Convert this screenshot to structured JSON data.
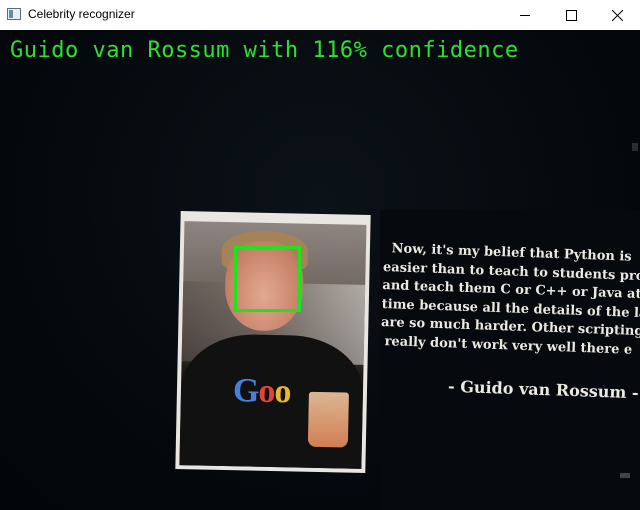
{
  "window": {
    "title": "Celebrity recognizer"
  },
  "overlay": {
    "label": "Guido van Rossum with 116% confidence",
    "color": "#2fe02f"
  },
  "photo": {
    "shirt_text": "Goo"
  },
  "quote": {
    "lines": [
      "Now, it's my belief that Python is",
      "easier than to teach to students prog",
      "and teach them C or C++ or Java at th",
      "time because all the details of the lan",
      "are so much harder. Other scripting la",
      "really don't work very well there e"
    ],
    "author": "- Guido van Rossum -"
  },
  "icons": {
    "app": "window-app-icon",
    "minimize": "minimize-icon",
    "maximize": "maximize-icon",
    "close": "close-icon"
  }
}
